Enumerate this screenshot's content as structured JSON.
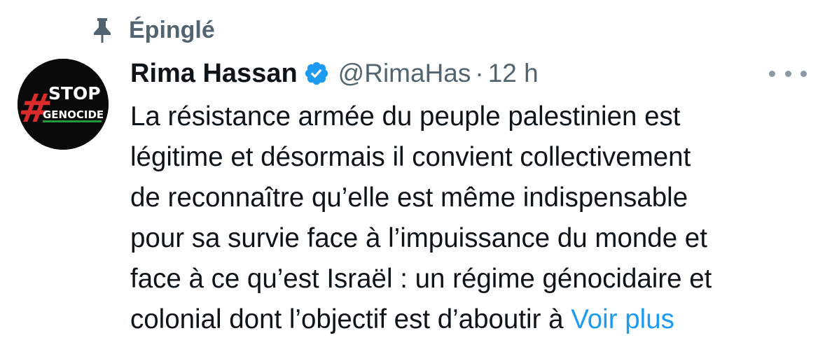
{
  "pinned": {
    "label": "Épinglé",
    "icon": "pin-icon"
  },
  "avatar": {
    "text_hash": "#",
    "text_stop": "STOP",
    "text_genocide": "GENOCIDE",
    "colors": {
      "background": "#0a0a0a",
      "hash": "#d92b2b",
      "text": "#ffffff",
      "accent": "#1f9a3c"
    }
  },
  "tweet": {
    "author_name": "Rima Hassan",
    "verified_icon": "verified-badge-icon",
    "handle": "@RimaHas",
    "separator": "·",
    "time": "12 h",
    "more_icon": "more-options-icon",
    "text_lines": [
      "La résistance armée du peuple palestinien est",
      "légitime et désormais il convient collectivement",
      "de reconnaître qu’elle est même indispensable",
      "pour sa survie face à l’impuissance du monde et",
      "face à ce qu’est Israël : un régime génocidaire et",
      "colonial dont l’objectif est d’aboutir à "
    ],
    "see_more": "Voir plus"
  },
  "colors": {
    "text_primary": "#0f1419",
    "text_secondary": "#536471",
    "link": "#1d9bf0",
    "verified": "#1d9bf0"
  }
}
